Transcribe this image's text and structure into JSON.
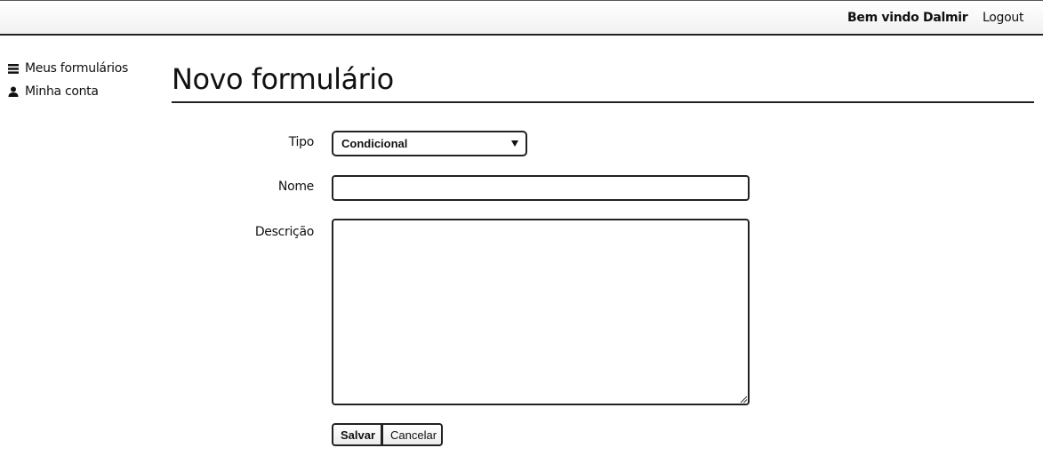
{
  "header": {
    "welcome_text": "Bem vindo Dalmir",
    "logout_label": "Logout"
  },
  "sidebar": {
    "items": [
      {
        "label": "Meus formulários",
        "icon": "list-icon"
      },
      {
        "label": "Minha conta",
        "icon": "user-icon"
      }
    ]
  },
  "main": {
    "title": "Novo formulário",
    "form": {
      "tipo_label": "Tipo",
      "tipo_value": "Condicional",
      "nome_label": "Nome",
      "nome_value": "",
      "descricao_label": "Descrição",
      "descricao_value": ""
    },
    "buttons": {
      "save_label": "Salvar",
      "cancel_label": "Cancelar"
    }
  }
}
